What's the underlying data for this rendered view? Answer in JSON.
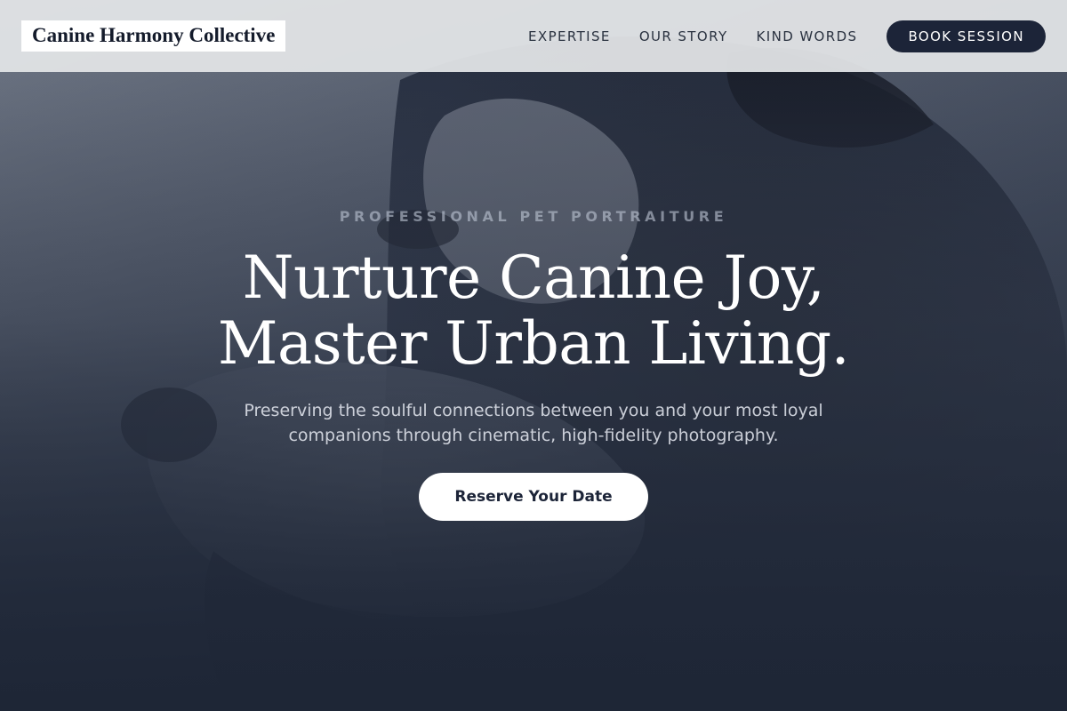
{
  "nav": {
    "brand": "Canine Harmony Collective",
    "links": [
      {
        "label": "EXPERTISE"
      },
      {
        "label": "OUR STORY"
      },
      {
        "label": "KIND WORDS"
      }
    ],
    "cta_label": "BOOK SESSION"
  },
  "hero": {
    "eyebrow": "PROFESSIONAL PET PORTRAITURE",
    "headline_line1": "Nurture Canine Joy,",
    "headline_line2": "Master Urban Living.",
    "subtitle": "Preserving the soulful connections between you and your most loyal companions through cinematic, high-fidelity photography.",
    "cta_label": "Reserve Your Date"
  },
  "colors": {
    "navy": "#1c2438",
    "nav_bg": "#e2e4e7",
    "white": "#ffffff"
  }
}
